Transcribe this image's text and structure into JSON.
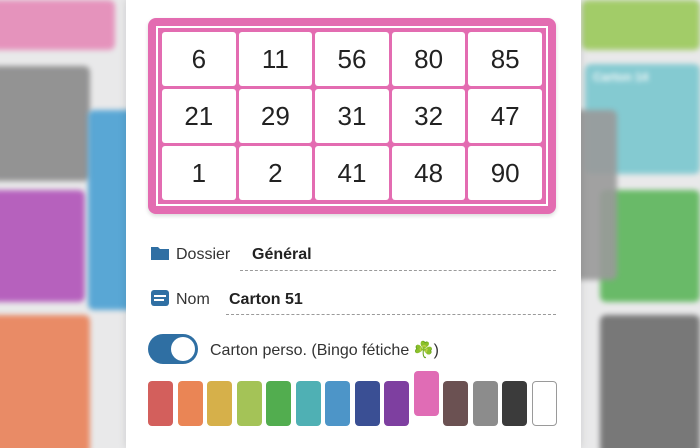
{
  "background_cards": [
    {
      "title": "",
      "color": "#e58ab8"
    },
    {
      "title": "",
      "color": "#8a8a8a"
    },
    {
      "title": "",
      "color": "#b153b9"
    },
    {
      "title": "",
      "color": "#e98158"
    },
    {
      "title": "",
      "color": "#9bc95b"
    },
    {
      "title": "Carton 14",
      "color": "#7ac7cf"
    },
    {
      "title": "",
      "color": "#5cb65a"
    },
    {
      "title": "",
      "color": "#6c6c6c"
    },
    {
      "title": "",
      "color": "#4aa0d3"
    }
  ],
  "card": {
    "accent_color": "#e36cb1",
    "numbers": [
      [
        6,
        11,
        56,
        80,
        85
      ],
      [
        21,
        29,
        31,
        32,
        47
      ],
      [
        1,
        2,
        41,
        48,
        90
      ]
    ]
  },
  "folder": {
    "label": "Dossier",
    "value": "Général",
    "icon": "folder-icon"
  },
  "name": {
    "label": "Nom",
    "value": "Carton 51",
    "icon": "name-tag-icon"
  },
  "toggle": {
    "label": "Carton perso. (Bingo fétiche ☘️)",
    "on": true
  },
  "colors": {
    "selected_index": 9,
    "swatches": [
      "#d35f5c",
      "#ea8555",
      "#d6b04a",
      "#a4c357",
      "#52ad4f",
      "#4fb0b4",
      "#4d95c8",
      "#3a4f94",
      "#7e3fa0",
      "#e06cb5",
      "#6b5152",
      "#8c8c8c",
      "#3b3b3b",
      "#ffffff"
    ]
  }
}
